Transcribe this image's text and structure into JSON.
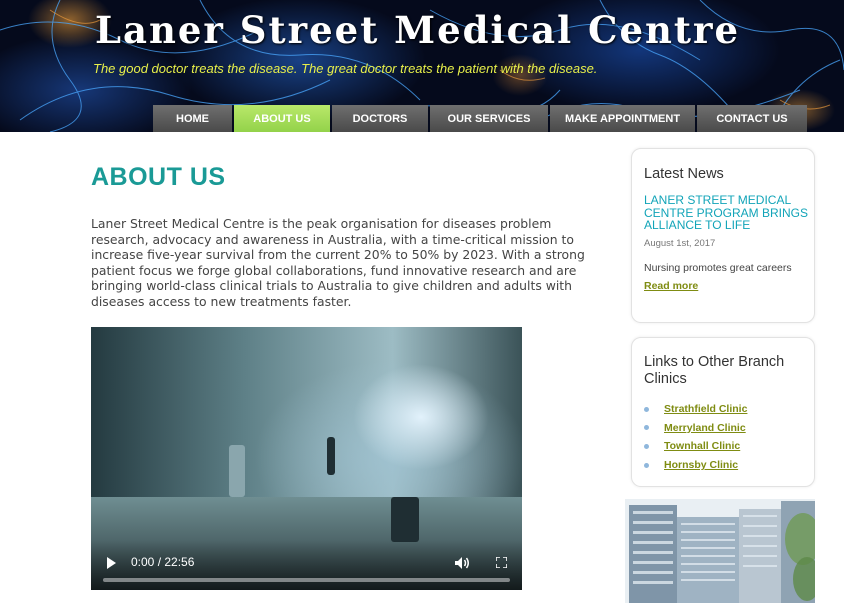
{
  "site": {
    "title": "Laner Street Medical Centre",
    "tagline": "The good doctor treats the disease. The great doctor treats the patient with the disease."
  },
  "nav": {
    "items": [
      {
        "label": "HOME",
        "active": false
      },
      {
        "label": "ABOUT US",
        "active": true
      },
      {
        "label": "DOCTORS",
        "active": false
      },
      {
        "label": "OUR SERVICES",
        "active": false
      },
      {
        "label": "MAKE APPOINTMENT",
        "active": false
      },
      {
        "label": "CONTACT US",
        "active": false
      }
    ]
  },
  "main": {
    "heading": "ABOUT US",
    "intro": "Laner Street Medical Centre is the peak organisation for diseases problem research, advocacy and awareness in Australia, with a time-critical mission to increase five-year survival from the current 20% to 50% by 2023. With a strong patient focus we forge global collaborations, fund innovative research and are bringing world-class clinical trials to Australia to give children and adults with diseases access to new treatments faster.",
    "video": {
      "time_display": "0:00 / 22:56",
      "progress": 0
    }
  },
  "sidebar": {
    "news": {
      "title": "Latest News",
      "headline": "LANER STREET MEDICAL CENTRE PROGRAM BRINGS ALLIANCE TO LIFE",
      "date": "August 1st, 2017",
      "summary": "Nursing promotes great careers",
      "read_more": "Read more"
    },
    "links": {
      "title": "Links to Other Branch Clinics",
      "clinics": [
        "Strathfield Clinic",
        "Merryland Clinic",
        "Townhall Clinic",
        "Hornsby Clinic"
      ]
    }
  },
  "colors": {
    "accent_teal": "#1a9a96",
    "nav_active": "#a6dd5a",
    "nav_default": "#5a5a5a",
    "tagline": "#e8f04a",
    "link_olive": "#7f8c12"
  }
}
